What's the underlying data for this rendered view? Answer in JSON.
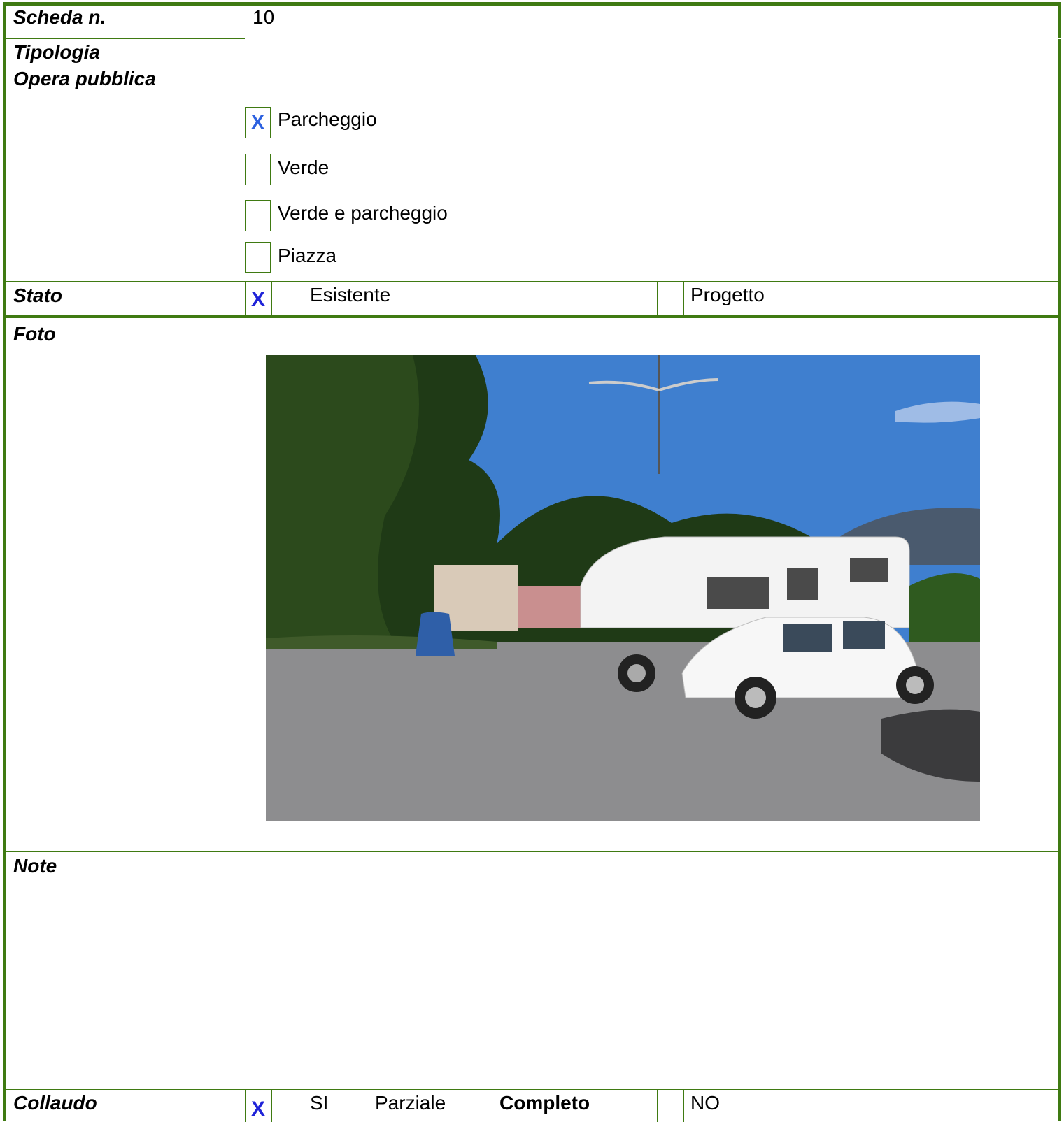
{
  "scheda": {
    "label": "Scheda n.",
    "value": "10"
  },
  "tipologia": {
    "label_line1": "Tipologia",
    "label_line2": "Opera pubblica",
    "options": [
      {
        "label": "Parcheggio",
        "checked": true,
        "mark": "X"
      },
      {
        "label": "Verde",
        "checked": false
      },
      {
        "label": "Verde e parcheggio",
        "checked": false
      },
      {
        "label": "Piazza",
        "checked": false
      }
    ]
  },
  "stato": {
    "label": "Stato",
    "mark": "X",
    "esistente": "Esistente",
    "progetto": "Progetto"
  },
  "foto": {
    "label": "Foto",
    "sky_color": "#3f7fcf",
    "tree_color": "#1f3a16",
    "asphalt_color": "#8d8d8f"
  },
  "note": {
    "label": "Note"
  },
  "collaudo": {
    "label": "Collaudo",
    "mark": "X",
    "si": "SI",
    "parziale": "Parziale",
    "completo": "Completo",
    "no": "NO"
  },
  "colors": {
    "border_green": "#3f7a12",
    "check_blue": "#2d61e0",
    "x_blue": "#1f23d8"
  }
}
